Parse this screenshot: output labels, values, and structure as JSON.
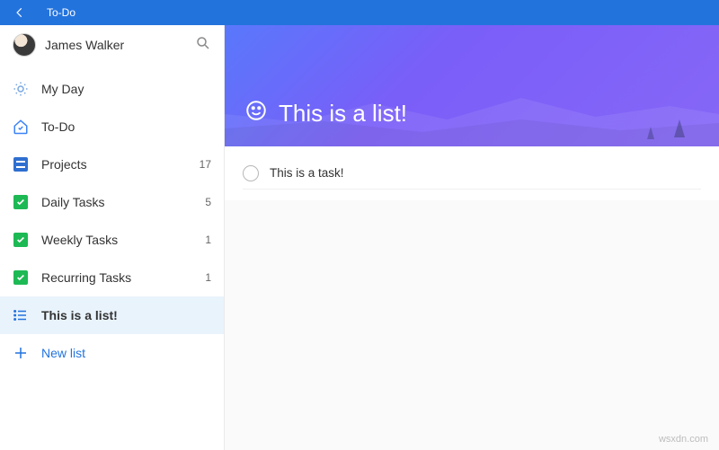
{
  "appTitle": "To-Do",
  "userName": "James Walker",
  "sidebar": {
    "items": [
      {
        "label": "My Day",
        "count": ""
      },
      {
        "label": "To-Do",
        "count": ""
      },
      {
        "label": "Projects",
        "count": "17"
      },
      {
        "label": "Daily Tasks",
        "count": "5"
      },
      {
        "label": "Weekly Tasks",
        "count": "1"
      },
      {
        "label": "Recurring Tasks",
        "count": "1"
      },
      {
        "label": "This is a list!",
        "count": ""
      }
    ],
    "newList": "New list"
  },
  "listHeader": "This is a list!",
  "tasks": [
    {
      "title": "This is a task!"
    }
  ],
  "watermark": "wsxdn.com"
}
